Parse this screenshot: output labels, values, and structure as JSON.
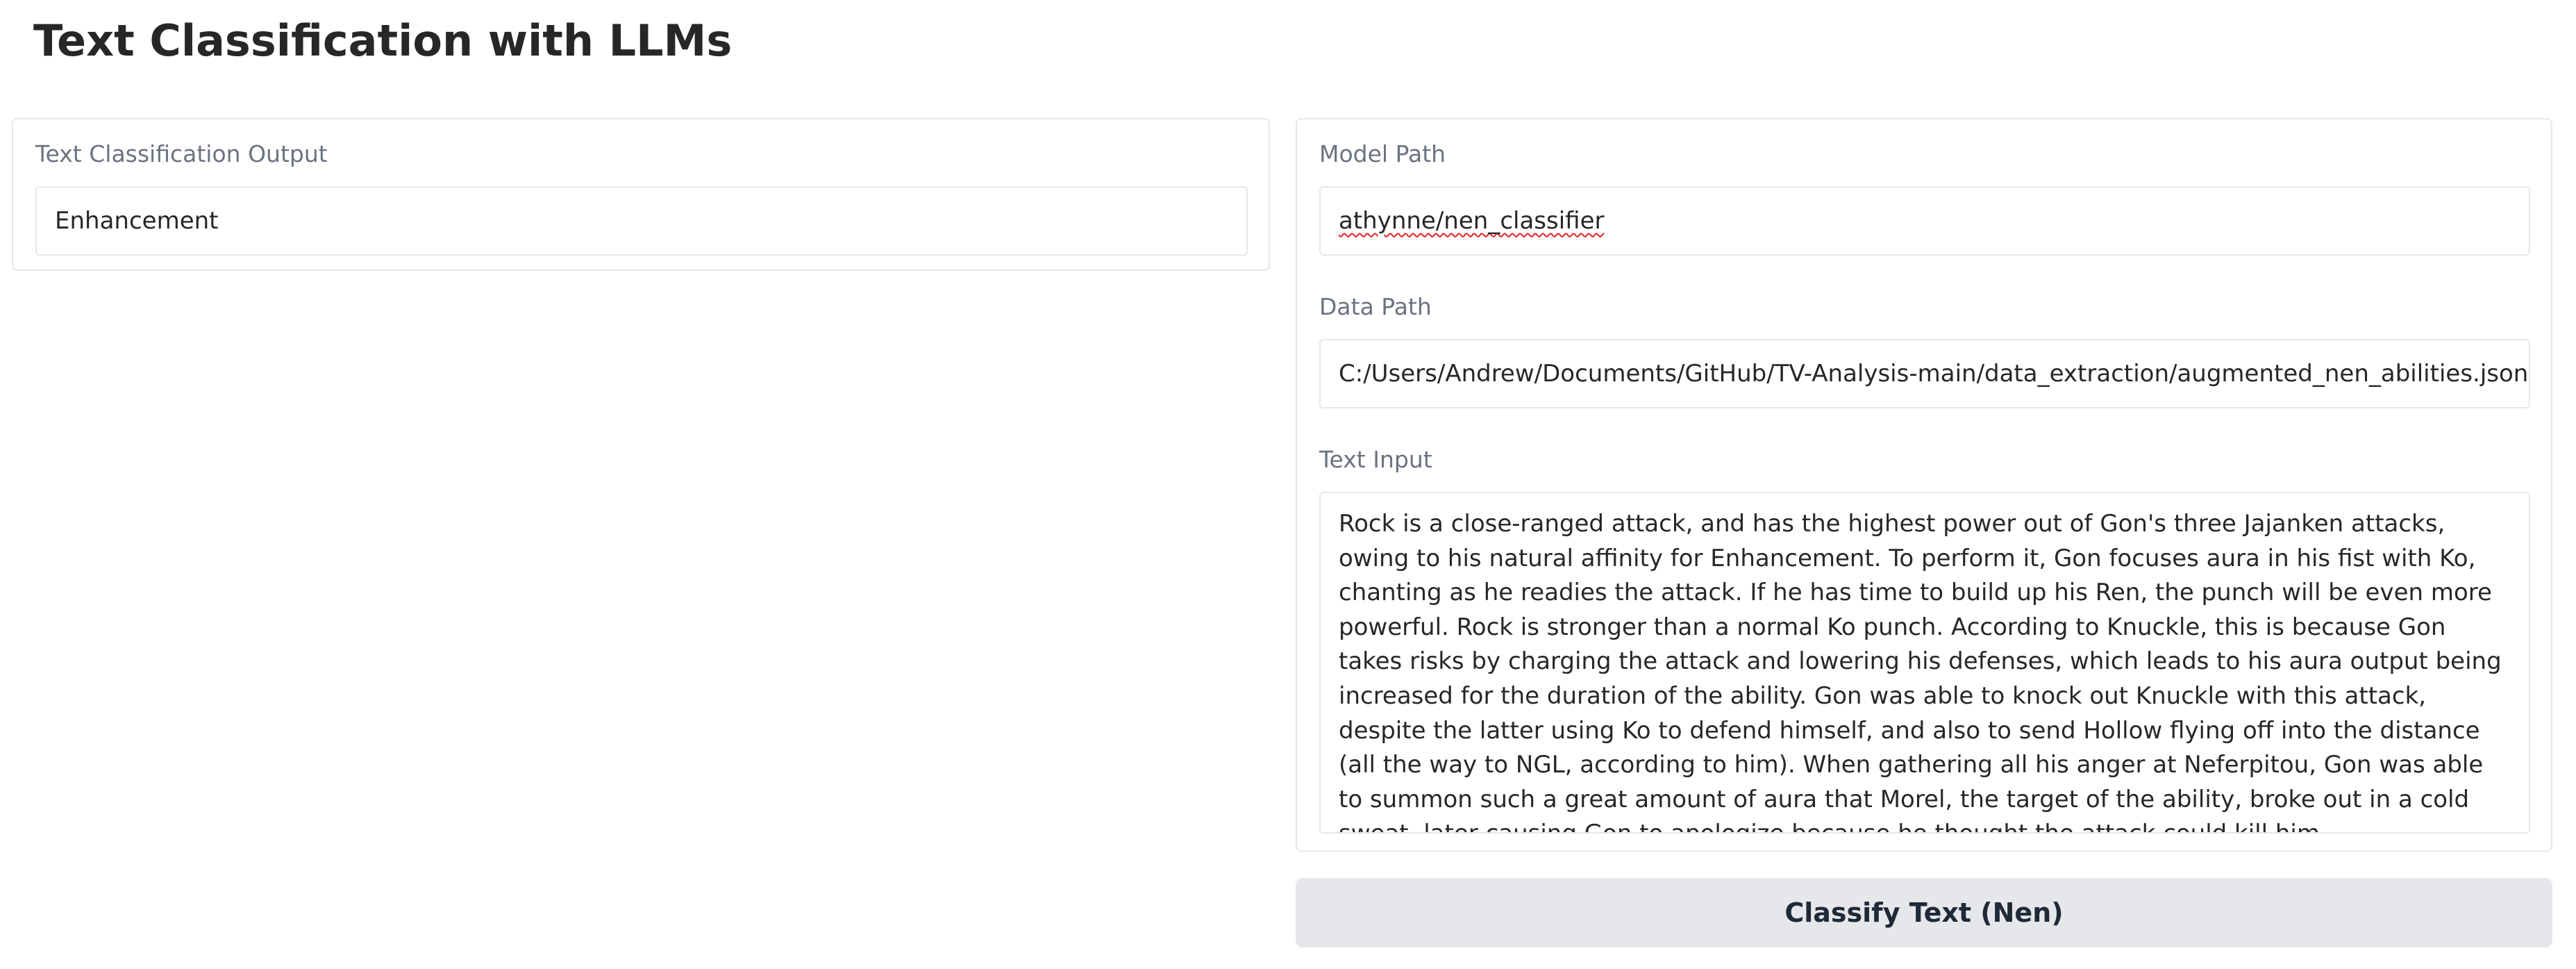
{
  "app": {
    "title": "Text Classification with LLMs"
  },
  "output": {
    "label": "Text Classification Output",
    "value": "Enhancement"
  },
  "model_path": {
    "label": "Model Path",
    "value": "athynne/nen_classifier"
  },
  "data_path": {
    "label": "Data Path",
    "value": "C:/Users/Andrew/Documents/GitHub/TV-Analysis-main/data_extraction/augmented_nen_abilities.jsonl"
  },
  "text_input": {
    "label": "Text Input",
    "value": "Rock is a close-ranged attack, and has the highest power out of Gon's three Jajanken attacks, owing to his natural affinity for Enhancement. To perform it, Gon focuses aura in his fist with Ko, chanting as he readies the attack. If he has time to build up his Ren, the punch will be even more powerful. Rock is stronger than a normal Ko punch. According to Knuckle, this is because Gon takes risks by charging the attack and lowering his defenses, which leads to his aura output being increased for the duration of the ability. Gon was able to knock out Knuckle with this attack, despite the latter using Ko to defend himself, and also to send Hollow flying off into the distance (all the way to NGL, according to him). When gathering all his anger at Neferpitou, Gon was able to summon such a great amount of aura that Morel, the target of the ability, broke out in a cold sweat, later causing Gon to apologize because he thought the attack could kill him."
  },
  "actions": {
    "classify_label": "Classify Text (Nen)"
  },
  "colors": {
    "background": "#ffffff",
    "border": "#e5e7eb",
    "button_bg": "#e5e7eb",
    "label_text": "#6b7280",
    "spellcheck_underline": "#e02424"
  }
}
